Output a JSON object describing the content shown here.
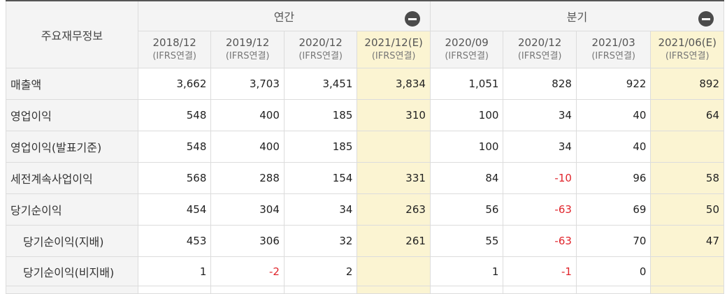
{
  "header": {
    "corner": "주요재무정보",
    "annual": "연간",
    "quarterly": "분기",
    "minus_icon": "minus-circle-icon"
  },
  "periods": [
    {
      "date": "2018/12",
      "basis": "(IFRS연결)",
      "estimate": false
    },
    {
      "date": "2019/12",
      "basis": "(IFRS연결)",
      "estimate": false
    },
    {
      "date": "2020/12",
      "basis": "(IFRS연결)",
      "estimate": false
    },
    {
      "date": "2021/12(E)",
      "basis": "(IFRS연결)",
      "estimate": true
    },
    {
      "date": "2020/09",
      "basis": "(IFRS연결)",
      "estimate": false
    },
    {
      "date": "2020/12",
      "basis": "(IFRS연결)",
      "estimate": false
    },
    {
      "date": "2021/03",
      "basis": "(IFRS연결)",
      "estimate": false
    },
    {
      "date": "2021/06(E)",
      "basis": "(IFRS연결)",
      "estimate": true
    }
  ],
  "rows": [
    {
      "label": "매출액",
      "indent": false,
      "values": [
        "3,662",
        "3,703",
        "3,451",
        "3,834",
        "1,051",
        "828",
        "922",
        "892"
      ]
    },
    {
      "label": "영업이익",
      "indent": false,
      "values": [
        "548",
        "400",
        "185",
        "310",
        "100",
        "34",
        "40",
        "64"
      ]
    },
    {
      "label": "영업이익(발표기준)",
      "indent": false,
      "values": [
        "548",
        "400",
        "185",
        "",
        "100",
        "34",
        "40",
        ""
      ]
    },
    {
      "label": "세전계속사업이익",
      "indent": false,
      "values": [
        "568",
        "288",
        "154",
        "331",
        "84",
        "-10",
        "96",
        "58"
      ]
    },
    {
      "label": "당기순이익",
      "indent": false,
      "values": [
        "454",
        "304",
        "34",
        "263",
        "56",
        "-63",
        "69",
        "50"
      ]
    },
    {
      "label": "당기순이익(지배)",
      "indent": true,
      "values": [
        "453",
        "306",
        "32",
        "261",
        "55",
        "-63",
        "70",
        "47"
      ]
    },
    {
      "label": "당기순이익(비지배)",
      "indent": true,
      "values": [
        "1",
        "-2",
        "2",
        "",
        "1",
        "-1",
        "0",
        ""
      ]
    }
  ],
  "colors": {
    "estimate_bg": "#fbf4d2",
    "negative": "#e0242b",
    "header_bg": "#f4f4f4"
  }
}
